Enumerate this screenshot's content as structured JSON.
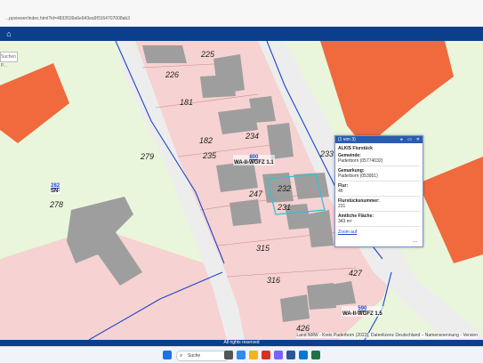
{
  "browser": {
    "url": "...ppviewer/index.html?id=4833539a6e943ea9f3164707008ab3"
  },
  "toolbar": {
    "home_icon": "home-icon",
    "search_placeholder": "Suchen P..."
  },
  "map": {
    "parcels": [
      {
        "id": "225",
        "label": "225"
      },
      {
        "id": "226",
        "label": "226"
      },
      {
        "id": "181",
        "label": "181"
      },
      {
        "id": "182",
        "label": "182"
      },
      {
        "id": "234",
        "label": "234"
      },
      {
        "id": "235",
        "label": "235"
      },
      {
        "id": "279",
        "label": "279"
      },
      {
        "id": "278",
        "label": "278"
      },
      {
        "id": "233",
        "label": "233"
      },
      {
        "id": "232",
        "label": "232"
      },
      {
        "id": "231",
        "label": "231"
      },
      {
        "id": "247",
        "label": "247"
      },
      {
        "id": "315",
        "label": "315"
      },
      {
        "id": "316",
        "label": "316"
      },
      {
        "id": "427",
        "label": "427"
      },
      {
        "id": "426",
        "label": "426"
      }
    ],
    "plan_labels": [
      {
        "num": "800",
        "text": "WA-II-WGFZ 1.1"
      },
      {
        "num": "282",
        "text": "SN-"
      },
      {
        "num": "590",
        "text": "WA-II-WGFZ 1.5"
      }
    ]
  },
  "popup": {
    "counter": "(1 von 3)",
    "title": "ALKIS Flurstück",
    "rows": [
      {
        "label": "Gemeinde:",
        "value": "Paderborn (05774032)"
      },
      {
        "label": "Gemarkung:",
        "value": "Paderborn (053951)"
      },
      {
        "label": "Flur:",
        "value": "46"
      },
      {
        "label": "Flurstücksnummer:",
        "value": "231"
      },
      {
        "label": "Amtliche Fläche:",
        "value": "343 m²"
      }
    ],
    "link": "Zoom auf",
    "more": "..."
  },
  "copyright": "Land NRW - Kreis Paderborn (2022), Datenlizenz Deutschland – Namensnennung - Version",
  "footer": "All rights reserved",
  "taskbar": {
    "search_label": "Suche"
  },
  "colors": {
    "toolbar": "#0b3f8c",
    "residential": "#f6d2d2",
    "green": "#e9f6dc",
    "building": "#9e9e9e",
    "orange": "#f06a3e"
  }
}
